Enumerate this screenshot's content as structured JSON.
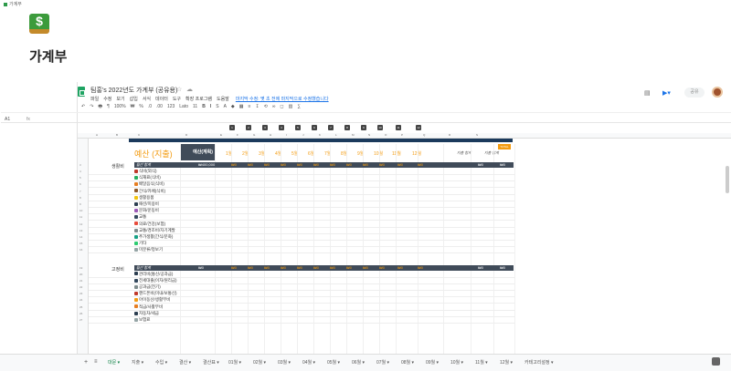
{
  "breadcrumb": "가계부",
  "page": {
    "title": "가계부",
    "icon": "money-icon"
  },
  "doc": {
    "title": "팀홍's 2022년도 가계부 (공유용)",
    "menu": [
      "파일",
      "수정",
      "보기",
      "삽입",
      "서식",
      "데이터",
      "도구",
      "확장 프로그램",
      "도움말"
    ],
    "saved_status": "마지막 수정: 몇 초 전에 마지막으로 수정했습니다",
    "share_label": "공유"
  },
  "toolbar": {
    "zoom": "100%",
    "font": "Lato",
    "font_size": "11",
    "items": [
      "↶",
      "↷",
      "🖶",
      "¶",
      "100%",
      "₩",
      "%",
      ".0",
      ".00",
      "123",
      "Lato",
      "11",
      "B",
      "I",
      "S",
      "A",
      "◆",
      "▦",
      "≡",
      "↧",
      "⟲",
      "∞",
      "◻",
      "▥",
      "∑"
    ]
  },
  "formula": {
    "cell_ref": "A1",
    "fx": "fx"
  },
  "sheet": {
    "columns": [
      "A",
      "B",
      "C",
      "D",
      "E",
      "F",
      "G",
      "H",
      "I",
      "J",
      "K",
      "L",
      "M",
      "N",
      "O",
      "P",
      "Q",
      "R",
      "S"
    ],
    "group_numbers": [
      "1",
      "2",
      "3",
      "4",
      "5",
      "6",
      "7",
      "8",
      "9",
      "10",
      "11",
      "12"
    ],
    "budget_label": "예산",
    "budget_sub": "(지출)",
    "plan_label": "예산(계획)",
    "months": [
      "1월",
      "2월",
      "3월",
      "4월",
      "5월",
      "6월",
      "7월",
      "8월",
      "9월",
      "10월",
      "11월",
      "12월"
    ],
    "tag": "TOTAL",
    "end_labels": [
      "지출 합계",
      "지출 합계"
    ],
    "sections": [
      {
        "category": "생활비",
        "header": "월간 합계",
        "plan": "₩400,000",
        "amounts": [
          "₩0",
          "₩0",
          "₩0",
          "₩0",
          "₩0",
          "₩0",
          "₩0",
          "₩0",
          "₩0",
          "₩0",
          "₩0",
          "₩0",
          "₩0",
          "₩0"
        ],
        "items": [
          {
            "label": "식비(외식)",
            "icon": "burger-icon",
            "color": "#c0392b"
          },
          {
            "label": "식재료(식비)",
            "icon": "leaf-icon",
            "color": "#27ae60"
          },
          {
            "label": "배달음식(식비)",
            "icon": "box-icon",
            "color": "#e67e22"
          },
          {
            "label": "간식/카페(식비)",
            "icon": "cup-icon",
            "color": "#8e5a2b"
          },
          {
            "label": "생활용품",
            "icon": "bag-icon",
            "color": "#f1c40f"
          },
          {
            "label": "패션/미용비",
            "icon": "shirt-icon",
            "color": "#2c3e50"
          },
          {
            "label": "문화/운동비",
            "icon": "ticket-icon",
            "color": "#9b59b6"
          },
          {
            "label": "교통",
            "icon": "bus-icon",
            "color": "#34495e"
          },
          {
            "label": "의료/건강(보험)",
            "icon": "medical-icon",
            "color": "#e74c3c"
          },
          {
            "label": "교통/경조비/자기계발",
            "icon": "book-icon",
            "color": "#7f8c8d"
          },
          {
            "label": "추가생활(간식/문화)",
            "icon": "gift-icon",
            "color": "#16a085"
          },
          {
            "label": "기타",
            "icon": "pin-icon",
            "color": "#2ecc71"
          },
          {
            "label": "미분류/정보기",
            "icon": "flag-icon",
            "color": "#95a5a6"
          }
        ]
      },
      {
        "category": "고정비",
        "header": "월간 합계",
        "plan": "₩0",
        "amounts": [
          "₩0",
          "₩0",
          "₩0",
          "₩0",
          "₩0",
          "₩0",
          "₩0",
          "₩0",
          "₩0",
          "₩0",
          "₩0",
          "₩0",
          "₩0",
          "₩0"
        ],
        "items": [
          {
            "label": "관리비(통신/공과금)",
            "icon": "home-icon",
            "color": "#2c3e50"
          },
          {
            "label": "전세대출(이자/원리금)",
            "icon": "house-icon",
            "color": "#34495e"
          },
          {
            "label": "공과금(전기)",
            "icon": "bolt-icon",
            "color": "#7f8c8d"
          },
          {
            "label": "핸드폰비(미내/보통신)",
            "icon": "phone-icon",
            "color": "#c0392b"
          },
          {
            "label": "아이동산/생활부비",
            "icon": "star-icon",
            "color": "#f39c12"
          },
          {
            "label": "적금/사활부비",
            "icon": "star-icon",
            "color": "#e67e22"
          },
          {
            "label": "자동차/세금",
            "icon": "car-icon",
            "color": "#2c3e50"
          },
          {
            "label": "보험료",
            "icon": "umbrella-icon",
            "color": "#95a5a6"
          }
        ]
      }
    ]
  },
  "tabs": [
    "대문",
    "지출",
    "수입",
    "결산",
    "결산표",
    "01월",
    "02월",
    "03월",
    "04월",
    "05월",
    "06월",
    "07월",
    "08월",
    "09월",
    "10월",
    "11월",
    "12월",
    "카테고리설정"
  ],
  "selected_tab": "대문"
}
